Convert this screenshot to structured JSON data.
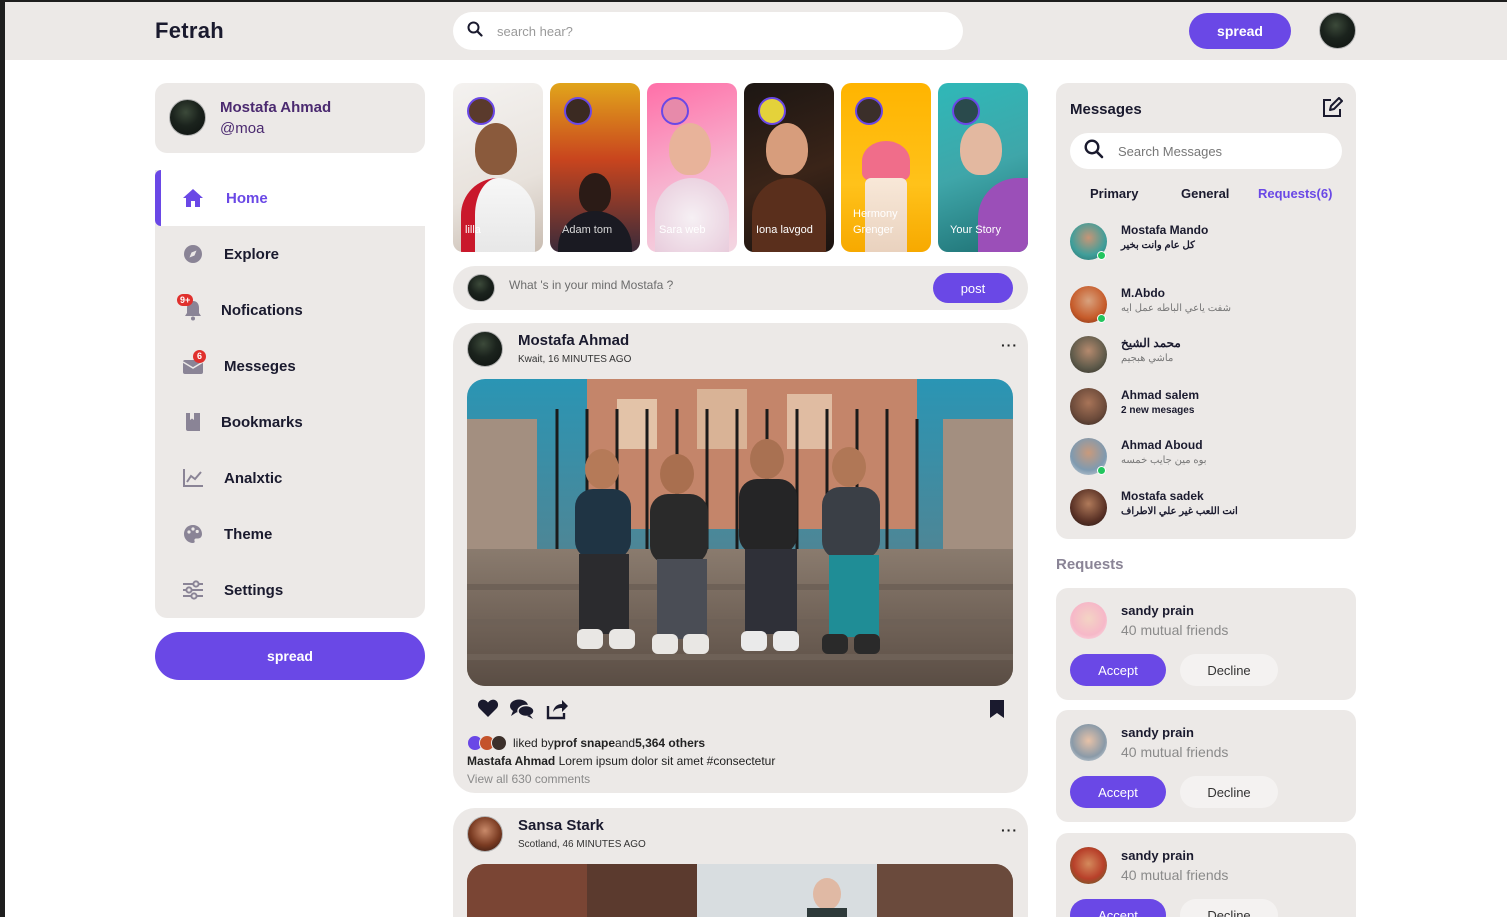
{
  "nav": {
    "logo": "Fetrah",
    "search_placeholder": "search hear?",
    "spread_label": "spread"
  },
  "profile": {
    "name": "Mostafa Ahmad",
    "handle": "@moa"
  },
  "sidebar": {
    "items": [
      {
        "label": "Home",
        "icon": "home-icon",
        "active": true
      },
      {
        "label": "Explore",
        "icon": "compass-icon"
      },
      {
        "label": "Nofications",
        "icon": "bell-icon",
        "badge": "9+"
      },
      {
        "label": "Messeges",
        "icon": "envelope-icon",
        "badge": "6"
      },
      {
        "label": "Bookmarks",
        "icon": "bookmark-icon"
      },
      {
        "label": "Analxtic",
        "icon": "chart-line-icon"
      },
      {
        "label": "Theme",
        "icon": "palette-icon"
      },
      {
        "label": "Settings",
        "icon": "sliders-icon"
      }
    ],
    "spread_label": "spread"
  },
  "stories": [
    {
      "name": "lilla"
    },
    {
      "name": "Adam tom"
    },
    {
      "name": "Sara web"
    },
    {
      "name": "Iona lavgod"
    },
    {
      "name": "Hermony Grenger"
    },
    {
      "name": "Your Story"
    }
  ],
  "compose": {
    "placeholder": "What 's in your mind Mostafa ?",
    "post_label": "post"
  },
  "feed": [
    {
      "author": "Mostafa Ahmad",
      "meta": "Kwait, 16 MINUTES AGO",
      "liked_prefix": "liked by ",
      "liked_user": "prof snape",
      "liked_and": "and ",
      "liked_others": "5,364 others",
      "caption_author": "Mastafa Ahmad",
      "caption_text": " Lorem ipsum dolor sit amet #consectetur",
      "comments": "View all 630 comments"
    },
    {
      "author": "Sansa Stark",
      "meta": "Scotland, 46 MINUTES AGO"
    }
  ],
  "messages": {
    "title": "Messages",
    "search_placeholder": "Search Messages",
    "tabs": [
      "Primary",
      "General",
      "Requests(6)"
    ],
    "contacts": [
      {
        "name": "Mostafa Mando",
        "message": "كل عام وانت بخير",
        "online": true,
        "bold": true
      },
      {
        "name": "M.Abdo",
        "message": "شفت ياعي الباطه عمل ايه",
        "online": true
      },
      {
        "name": "محمد الشيخ",
        "message": "ماشي هبجيم"
      },
      {
        "name": "Ahmad salem",
        "message": "2 new mesages",
        "bold": true
      },
      {
        "name": "Ahmad Aboud",
        "message": "بوه مين جايب خمسه",
        "online": true
      },
      {
        "name": "Mostafa sadek",
        "message": "انت اللعب غير علي الاطراف",
        "bold": true
      }
    ]
  },
  "requests": {
    "heading": "Requests",
    "items": [
      {
        "name": "sandy prain",
        "mutual": "40 mutual friends",
        "accept": "Accept",
        "decline": "Decline"
      },
      {
        "name": "sandy prain",
        "mutual": "40 mutual friends",
        "accept": "Accept",
        "decline": "Decline"
      },
      {
        "name": "sandy prain",
        "mutual": "40 mutual friends",
        "accept": "Accept",
        "decline": "Decline"
      }
    ]
  },
  "colors": {
    "accent": "#6a48e6",
    "panel": "#ece9e7"
  }
}
